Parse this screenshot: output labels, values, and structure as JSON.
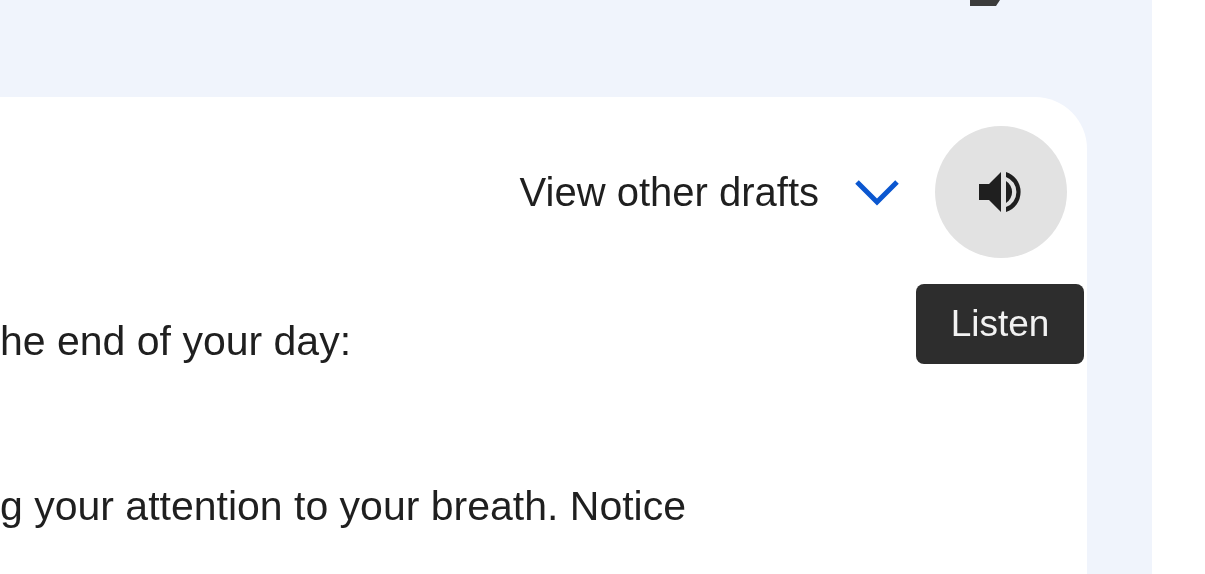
{
  "header": {
    "drafts_label": "View other drafts",
    "listen_tooltip": "Listen"
  },
  "paragraphs": [
    "he end of your day:",
    "g your attention to your breath. Notice"
  ]
}
